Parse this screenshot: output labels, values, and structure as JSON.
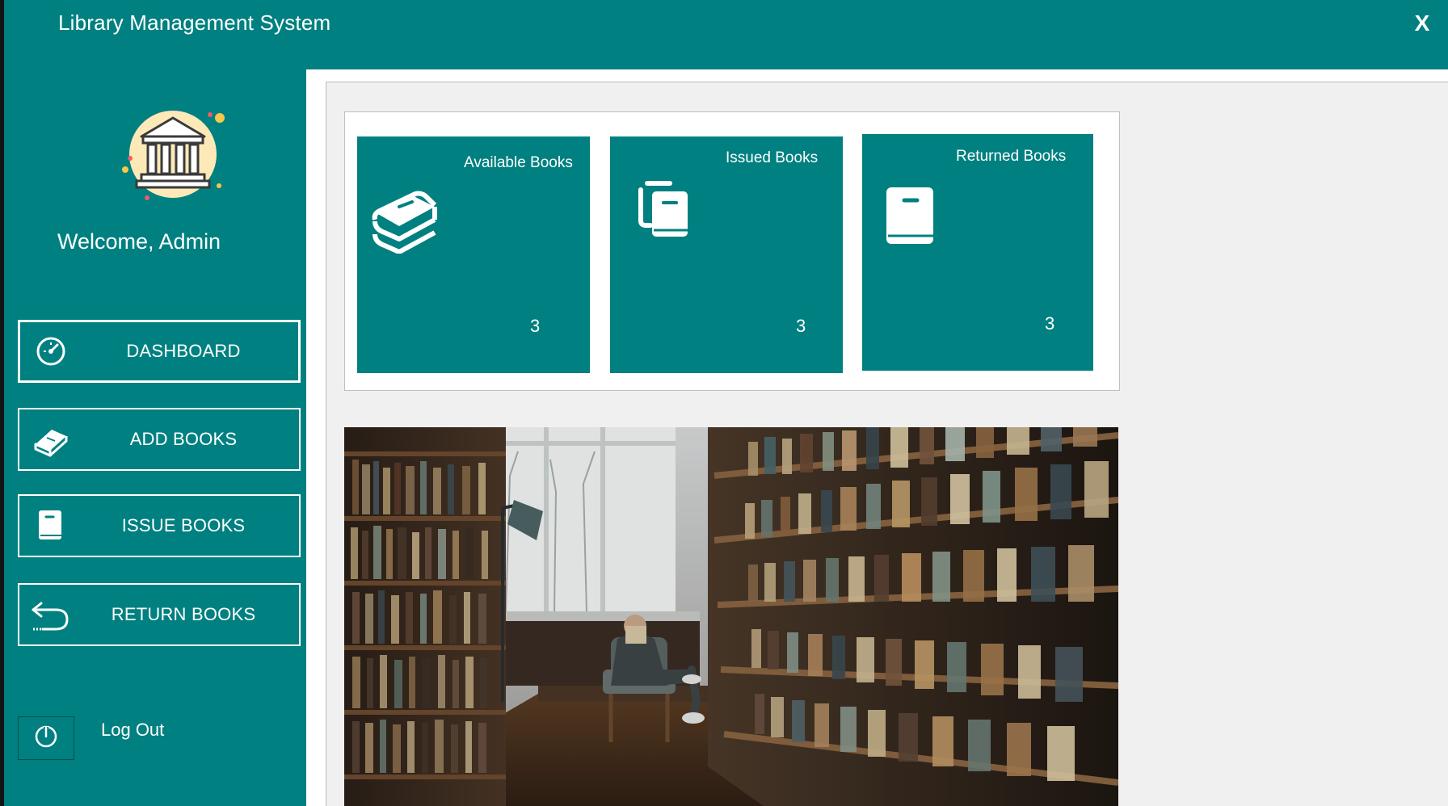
{
  "window": {
    "title": "Library Management System",
    "close_label": "X"
  },
  "colors": {
    "teal": "#008080",
    "panel_bg": "#f0f0f0",
    "text_on_teal": "#ffffff"
  },
  "sidebar": {
    "avatar_icon": "library-building-icon",
    "welcome_text": "Welcome, Admin",
    "items": [
      {
        "label": "DASHBOARD",
        "icon": "dashboard-gauge-icon",
        "active": true
      },
      {
        "label": "ADD BOOKS",
        "icon": "book-icon",
        "active": false
      },
      {
        "label": "ISSUE BOOKS",
        "icon": "single-book-icon",
        "active": false
      },
      {
        "label": "RETURN BOOKS",
        "icon": "return-arrow-icon",
        "active": false
      }
    ],
    "logout": {
      "label": "Log Out",
      "icon": "power-icon"
    }
  },
  "dashboard": {
    "cards": [
      {
        "title": "Available Books",
        "count": "3",
        "icon": "books-stack-icon"
      },
      {
        "title": "Issued Books",
        "count": "3",
        "icon": "copy-books-icon"
      },
      {
        "title": "Returned Books",
        "count": "3",
        "icon": "single-book-icon"
      }
    ],
    "image": {
      "subject": "library-reading-photo"
    }
  }
}
